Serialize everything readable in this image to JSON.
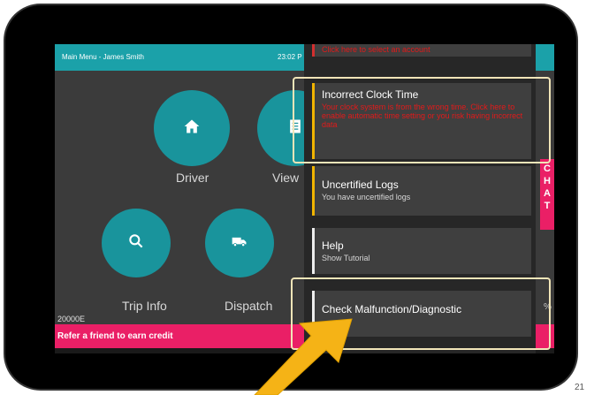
{
  "header": {
    "title": "Main Menu - James Smith",
    "time": "23:02 P"
  },
  "tiles": [
    {
      "label": "Driver",
      "icon": "home-icon"
    },
    {
      "label": "View",
      "icon": "log-icon"
    },
    {
      "label": "Trip Info",
      "icon": "search-icon"
    },
    {
      "label": "Dispatch",
      "icon": "truck-icon"
    }
  ],
  "device_id": "20000E",
  "refer": {
    "label": "Refer a friend to earn credit"
  },
  "chat": {
    "letters": [
      "C",
      "H",
      "A",
      "T"
    ]
  },
  "notifications": [
    {
      "title": "",
      "subtitle": "Click here to select an account",
      "accent": "#d32f2f",
      "subtitle_color": "red"
    },
    {
      "title": "Incorrect Clock Time",
      "subtitle": "Your clock system is from the wrong time. Click here to enable automatic time setting or you risk having incorrect data",
      "accent": "#f0b400",
      "subtitle_color": "red"
    },
    {
      "title": "Uncertified Logs",
      "subtitle": "You have uncertified logs",
      "accent": "#f0b400",
      "subtitle_color": "grey"
    },
    {
      "title": "Help",
      "subtitle": "Show Tutorial",
      "accent": "#eeeeee",
      "subtitle_color": "grey"
    },
    {
      "title": "Check Malfunction/Diagnostic",
      "subtitle": "",
      "accent": "#eeeeee",
      "subtitle_color": "grey"
    }
  ],
  "side_percent": "%",
  "corner_text": "21",
  "colors": {
    "teal": "#19949c",
    "pink": "#ea1f66",
    "arrow": "#f5b316",
    "highlight": "#f1e5b8"
  }
}
